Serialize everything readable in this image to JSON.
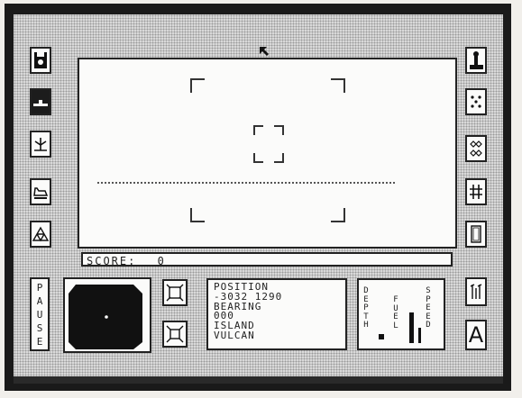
{
  "left_toolbar": {
    "icons": [
      "disk-icon",
      "ship-icon",
      "radar-dish-icon",
      "hover-vehicle-icon",
      "geodesic-dome-icon"
    ],
    "selected_index": 1
  },
  "right_toolbar": {
    "icons": [
      "joystick-icon",
      "dice-icon",
      "diamond-grid-icon",
      "hash-grid-icon",
      "panel-frame-icon",
      "waves-icon",
      "letter-a-icon"
    ]
  },
  "score": {
    "label": "SCORE:",
    "value": "0"
  },
  "pause": {
    "label": "PAUSE"
  },
  "info": {
    "position_label": "POSITION",
    "position_value": "-3032 1290",
    "bearing_label": "BEARING",
    "bearing_value": "000",
    "location_line1": "ISLAND",
    "location_line2": "VULCAN"
  },
  "gauges": {
    "left_label": "DEPTH",
    "middle_label": "FUEL",
    "right_label": "SPEED",
    "fuel_level": 0.55,
    "speed_level": 0.85
  },
  "right_bottom_letter": "A",
  "colors": {
    "screen_bg": "#d9d9d9",
    "panel_bg": "#fbfbfa",
    "ink": "#1c1c1c"
  }
}
